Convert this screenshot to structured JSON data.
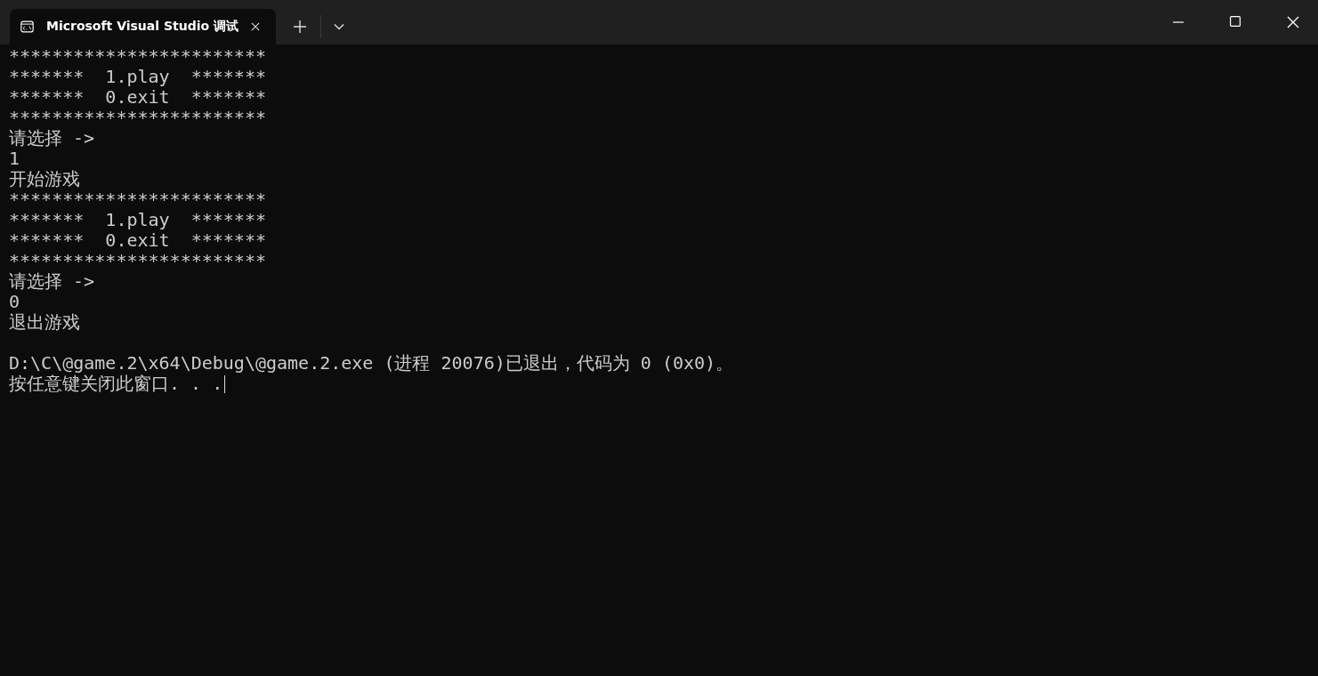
{
  "window": {
    "tab": {
      "title": "Microsoft Visual Studio 调试",
      "selected": true
    }
  },
  "terminal": {
    "lines": [
      "************************",
      "*******  1.play  *******",
      "*******  0.exit  *******",
      "************************",
      "请选择 ->",
      "1",
      "开始游戏",
      "************************",
      "*******  1.play  *******",
      "*******  0.exit  *******",
      "************************",
      "请选择 ->",
      "0",
      "退出游戏"
    ],
    "exit_lines": [
      "D:\\C\\@game.2\\x64\\Debug\\@game.2.exe (进程 20076)已退出，代码为 0 (0x0)。",
      "按任意键关闭此窗口. . ."
    ],
    "cursor": true
  }
}
